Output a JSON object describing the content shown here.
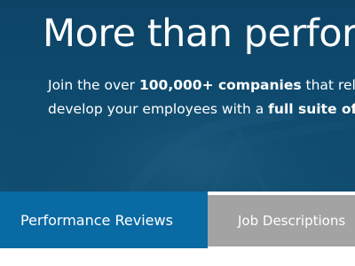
{
  "hero": {
    "headline": "More than performance",
    "intro": {
      "line1_prefix": "Join the over ",
      "line1_bold": "100,000+ companies",
      "line1_suffix": " that rely on us to",
      "line2_prefix": "develop your employees with a ",
      "line2_bold": "full suite of tools"
    }
  },
  "tabs": [
    {
      "label": "Performance Reviews",
      "active": true
    },
    {
      "label": "Job Descriptions",
      "active": false
    }
  ],
  "colors": {
    "hero_background": "#0e4a6e",
    "active_tab": "#0a6aa3",
    "inactive_tab": "#a3a3a3"
  }
}
